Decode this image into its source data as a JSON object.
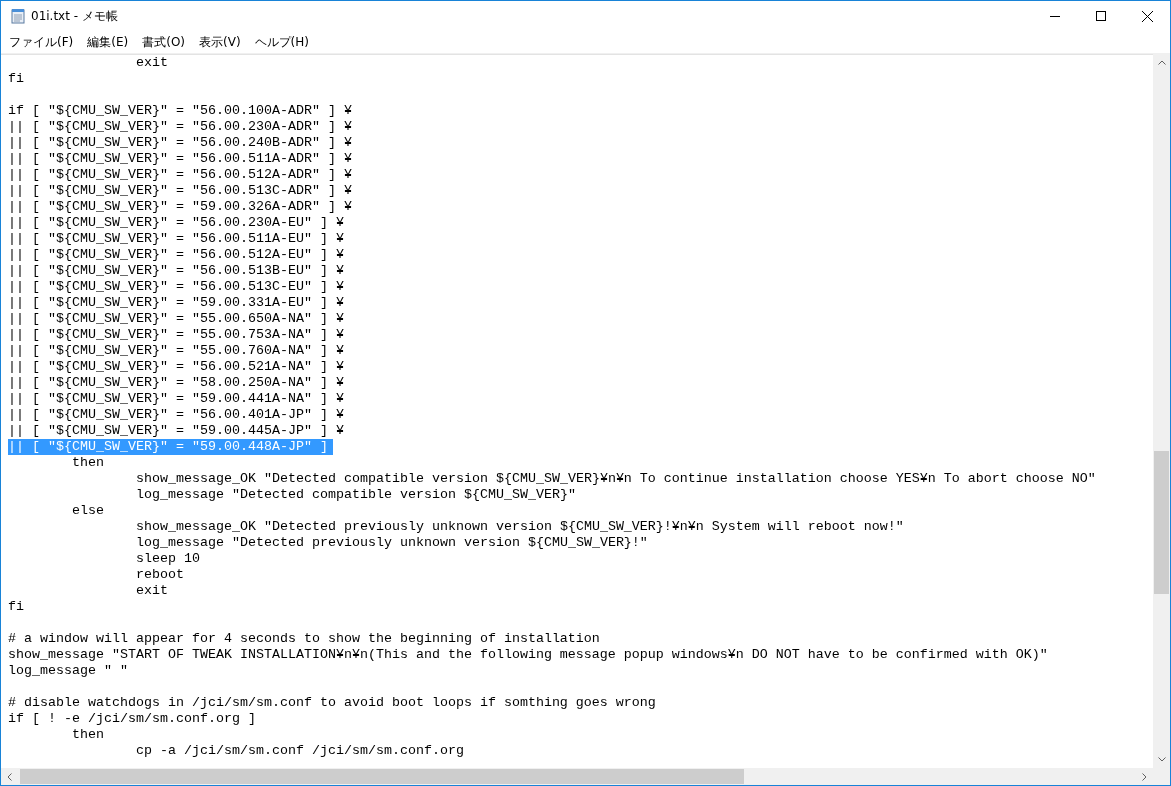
{
  "window": {
    "title": "01i.txt - メモ帳"
  },
  "menu": [
    {
      "label": "ファイル(F)"
    },
    {
      "label": "編集(E)"
    },
    {
      "label": "書式(O)"
    },
    {
      "label": "表示(V)"
    },
    {
      "label": "ヘルプ(H)"
    }
  ],
  "lines": [
    {
      "kind": "code",
      "text": "\t\texit",
      "selected": false
    },
    {
      "kind": "code",
      "text": "fi",
      "selected": false
    },
    {
      "kind": "blank",
      "selected": false
    },
    {
      "kind": "code",
      "text": "if [ \"${CMU_SW_VER}\" = \"56.00.100A-ADR\" ] ¥",
      "selected": false
    },
    {
      "kind": "code",
      "text": "|| [ \"${CMU_SW_VER}\" = \"56.00.230A-ADR\" ] ¥",
      "selected": false
    },
    {
      "kind": "code",
      "text": "|| [ \"${CMU_SW_VER}\" = \"56.00.240B-ADR\" ] ¥",
      "selected": false
    },
    {
      "kind": "code",
      "text": "|| [ \"${CMU_SW_VER}\" = \"56.00.511A-ADR\" ] ¥",
      "selected": false
    },
    {
      "kind": "code",
      "text": "|| [ \"${CMU_SW_VER}\" = \"56.00.512A-ADR\" ] ¥",
      "selected": false
    },
    {
      "kind": "code",
      "text": "|| [ \"${CMU_SW_VER}\" = \"56.00.513C-ADR\" ] ¥",
      "selected": false
    },
    {
      "kind": "code",
      "text": "|| [ \"${CMU_SW_VER}\" = \"59.00.326A-ADR\" ] ¥",
      "selected": false
    },
    {
      "kind": "code",
      "text": "|| [ \"${CMU_SW_VER}\" = \"56.00.230A-EU\" ] ¥",
      "selected": false
    },
    {
      "kind": "code",
      "text": "|| [ \"${CMU_SW_VER}\" = \"56.00.511A-EU\" ] ¥",
      "selected": false
    },
    {
      "kind": "code",
      "text": "|| [ \"${CMU_SW_VER}\" = \"56.00.512A-EU\" ] ¥",
      "selected": false
    },
    {
      "kind": "code",
      "text": "|| [ \"${CMU_SW_VER}\" = \"56.00.513B-EU\" ] ¥",
      "selected": false
    },
    {
      "kind": "code",
      "text": "|| [ \"${CMU_SW_VER}\" = \"56.00.513C-EU\" ] ¥",
      "selected": false
    },
    {
      "kind": "code",
      "text": "|| [ \"${CMU_SW_VER}\" = \"59.00.331A-EU\" ] ¥",
      "selected": false
    },
    {
      "kind": "code",
      "text": "|| [ \"${CMU_SW_VER}\" = \"55.00.650A-NA\" ] ¥",
      "selected": false
    },
    {
      "kind": "code",
      "text": "|| [ \"${CMU_SW_VER}\" = \"55.00.753A-NA\" ] ¥",
      "selected": false
    },
    {
      "kind": "code",
      "text": "|| [ \"${CMU_SW_VER}\" = \"55.00.760A-NA\" ] ¥",
      "selected": false
    },
    {
      "kind": "code",
      "text": "|| [ \"${CMU_SW_VER}\" = \"56.00.521A-NA\" ] ¥",
      "selected": false
    },
    {
      "kind": "code",
      "text": "|| [ \"${CMU_SW_VER}\" = \"58.00.250A-NA\" ] ¥",
      "selected": false
    },
    {
      "kind": "code",
      "text": "|| [ \"${CMU_SW_VER}\" = \"59.00.441A-NA\" ] ¥",
      "selected": false
    },
    {
      "kind": "code",
      "text": "|| [ \"${CMU_SW_VER}\" = \"56.00.401A-JP\" ] ¥",
      "selected": false
    },
    {
      "kind": "code",
      "text": "|| [ \"${CMU_SW_VER}\" = \"59.00.445A-JP\" ] ¥",
      "selected": false
    },
    {
      "kind": "code",
      "text": "|| [ \"${CMU_SW_VER}\" = \"59.00.448A-JP\" ]",
      "selected": true
    },
    {
      "kind": "code",
      "text": "\tthen",
      "selected": false
    },
    {
      "kind": "code",
      "text": "\t\tshow_message_OK \"Detected compatible version ${CMU_SW_VER}¥n¥n To continue installation choose YES¥n To abort choose NO\"",
      "selected": false
    },
    {
      "kind": "code",
      "text": "\t\tlog_message \"Detected compatible version ${CMU_SW_VER}\"",
      "selected": false
    },
    {
      "kind": "code",
      "text": "\telse",
      "selected": false
    },
    {
      "kind": "code",
      "text": "\t\tshow_message_OK \"Detected previously unknown version ${CMU_SW_VER}!¥n¥n System will reboot now!\"",
      "selected": false
    },
    {
      "kind": "code",
      "text": "\t\tlog_message \"Detected previously unknown version ${CMU_SW_VER}!\"",
      "selected": false
    },
    {
      "kind": "code",
      "text": "\t\tsleep 10",
      "selected": false
    },
    {
      "kind": "code",
      "text": "\t\treboot",
      "selected": false
    },
    {
      "kind": "code",
      "text": "\t\texit",
      "selected": false
    },
    {
      "kind": "code",
      "text": "fi",
      "selected": false
    },
    {
      "kind": "blank",
      "selected": false
    },
    {
      "kind": "code",
      "text": "# a window will appear for 4 seconds to show the beginning of installation",
      "selected": false
    },
    {
      "kind": "code",
      "text": "show_message \"START OF TWEAK INSTALLATION¥n¥n(This and the following message popup windows¥n DO NOT have to be confirmed with OK)\"",
      "selected": false
    },
    {
      "kind": "code",
      "text": "log_message \" \"",
      "selected": false
    },
    {
      "kind": "blank",
      "selected": false
    },
    {
      "kind": "code",
      "text": "# disable watchdogs in /jci/sm/sm.conf to avoid boot loops if somthing goes wrong",
      "selected": false
    },
    {
      "kind": "code",
      "text": "if [ ! -e /jci/sm/sm.conf.org ]",
      "selected": false
    },
    {
      "kind": "code",
      "text": "\tthen",
      "selected": false
    },
    {
      "kind": "code",
      "text": "\t\tcp -a /jci/sm/sm.conf /jci/sm/sm.conf.org",
      "selected": false
    }
  ]
}
